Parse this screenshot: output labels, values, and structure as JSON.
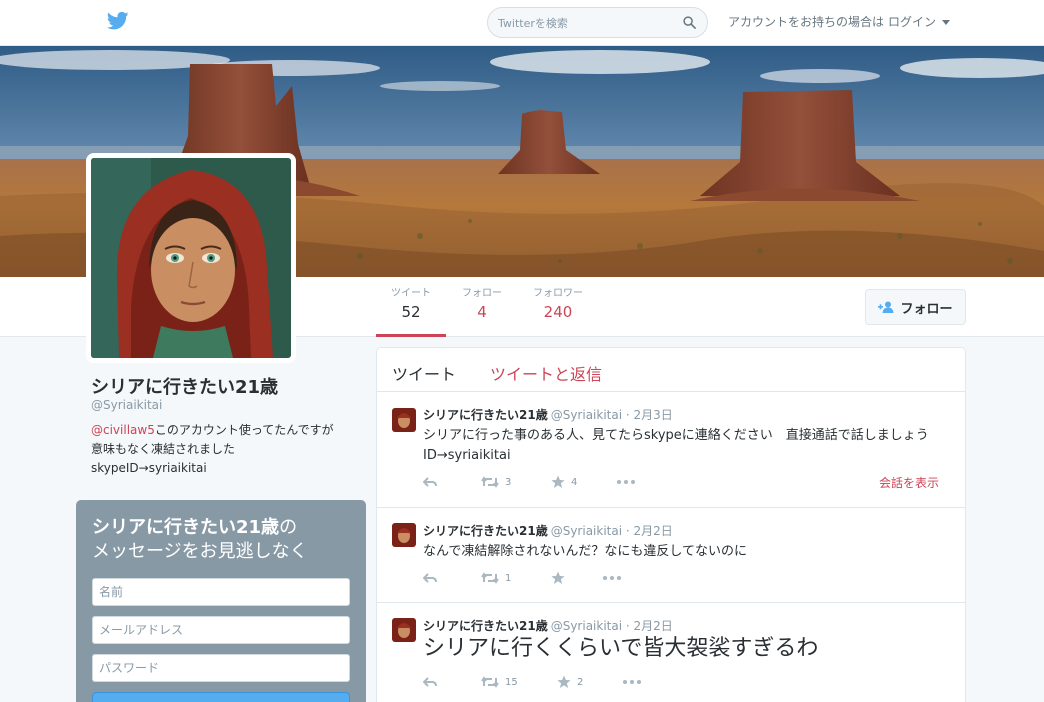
{
  "colors": {
    "accent": "#cc4455",
    "twitter_blue": "#55acee",
    "muted": "#8899a6",
    "text": "#292f33",
    "signup_bg": "#8899a6"
  },
  "header": {
    "logo_icon": "twitter-bird-icon",
    "search_placeholder": "Twitterを検索",
    "login_prompt": "アカウントをお持ちの場合は",
    "login_label": "ログイン"
  },
  "nav": {
    "stats": [
      {
        "label": "ツイート",
        "value": "52"
      },
      {
        "label": "フォロー",
        "value": "4"
      },
      {
        "label": "フォロワー",
        "value": "240"
      }
    ],
    "follow_label": "フォロー"
  },
  "profile": {
    "name": "シリアに行きたい21歳",
    "handle": "@Syriaikitai",
    "bio_mention": "@civillaw5",
    "bio_line1": "このアカウント使ってたんですが",
    "bio_line2": "意味もなく凍結されました",
    "bio_line3": "skypeID→syriaikitai"
  },
  "signup": {
    "title_name": "シリアに行きたい21歳",
    "title_suffix": "の",
    "title_line2": "メッセージをお見逃しなく",
    "name_placeholder": "名前",
    "email_placeholder": "メールアドレス",
    "password_placeholder": "パスワード"
  },
  "timeline": {
    "tabs": [
      "ツイート",
      "ツイートと返信"
    ],
    "tweets": [
      {
        "name": "シリアに行きたい21歳",
        "handle": "@Syriaikitai",
        "date": "· 2月3日",
        "text": "シリアに行った事のある人、見てたらskypeに連絡ください　直接通話で話しましょう　ID→syriaikitai",
        "retweets": "3",
        "favorites": "4",
        "conversation": "会話を表示"
      },
      {
        "name": "シリアに行きたい21歳",
        "handle": "@Syriaikitai",
        "date": "· 2月2日",
        "text": "なんで凍結解除されないんだ？なにも違反してないのに",
        "retweets": "1",
        "favorites": ""
      },
      {
        "name": "シリアに行きたい21歳",
        "handle": "@Syriaikitai",
        "date": "· 2月2日",
        "text": "シリアに行くくらいで皆大袈裟すぎるわ",
        "retweets": "15",
        "favorites": "2"
      }
    ]
  }
}
